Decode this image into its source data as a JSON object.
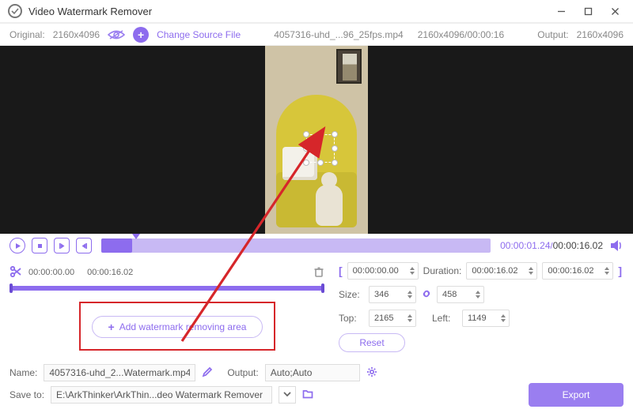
{
  "window": {
    "title": "Video Watermark Remover"
  },
  "header": {
    "original_label": "Original:",
    "original_res": "2160x4096",
    "change_source": "Change Source File",
    "filename": "4057316-uhd_...96_25fps.mp4",
    "file_res_dur": "2160x4096/00:00:16",
    "output_label": "Output:",
    "output_res": "2160x4096"
  },
  "player": {
    "current_time": "00:00:01.24",
    "total_time": "00:00:16.02"
  },
  "trim": {
    "start": "00:00:00.00",
    "end": "00:00:16.02"
  },
  "add_btn": "Add watermark removing area",
  "range": {
    "from": "00:00:00.00",
    "duration_label": "Duration:",
    "duration_val": "00:00:16.02",
    "to": "00:00:16.02"
  },
  "size": {
    "label": "Size:",
    "w": "346",
    "h": "458"
  },
  "pos": {
    "top_label": "Top:",
    "top": "2165",
    "left_label": "Left:",
    "left": "1149"
  },
  "reset": "Reset",
  "footer": {
    "name_label": "Name:",
    "name_val": "4057316-uhd_2...Watermark.mp4",
    "output_label": "Output:",
    "output_val": "Auto;Auto",
    "save_label": "Save to:",
    "save_val": "E:\\ArkThinker\\ArkThin...deo Watermark Remover",
    "export": "Export"
  }
}
